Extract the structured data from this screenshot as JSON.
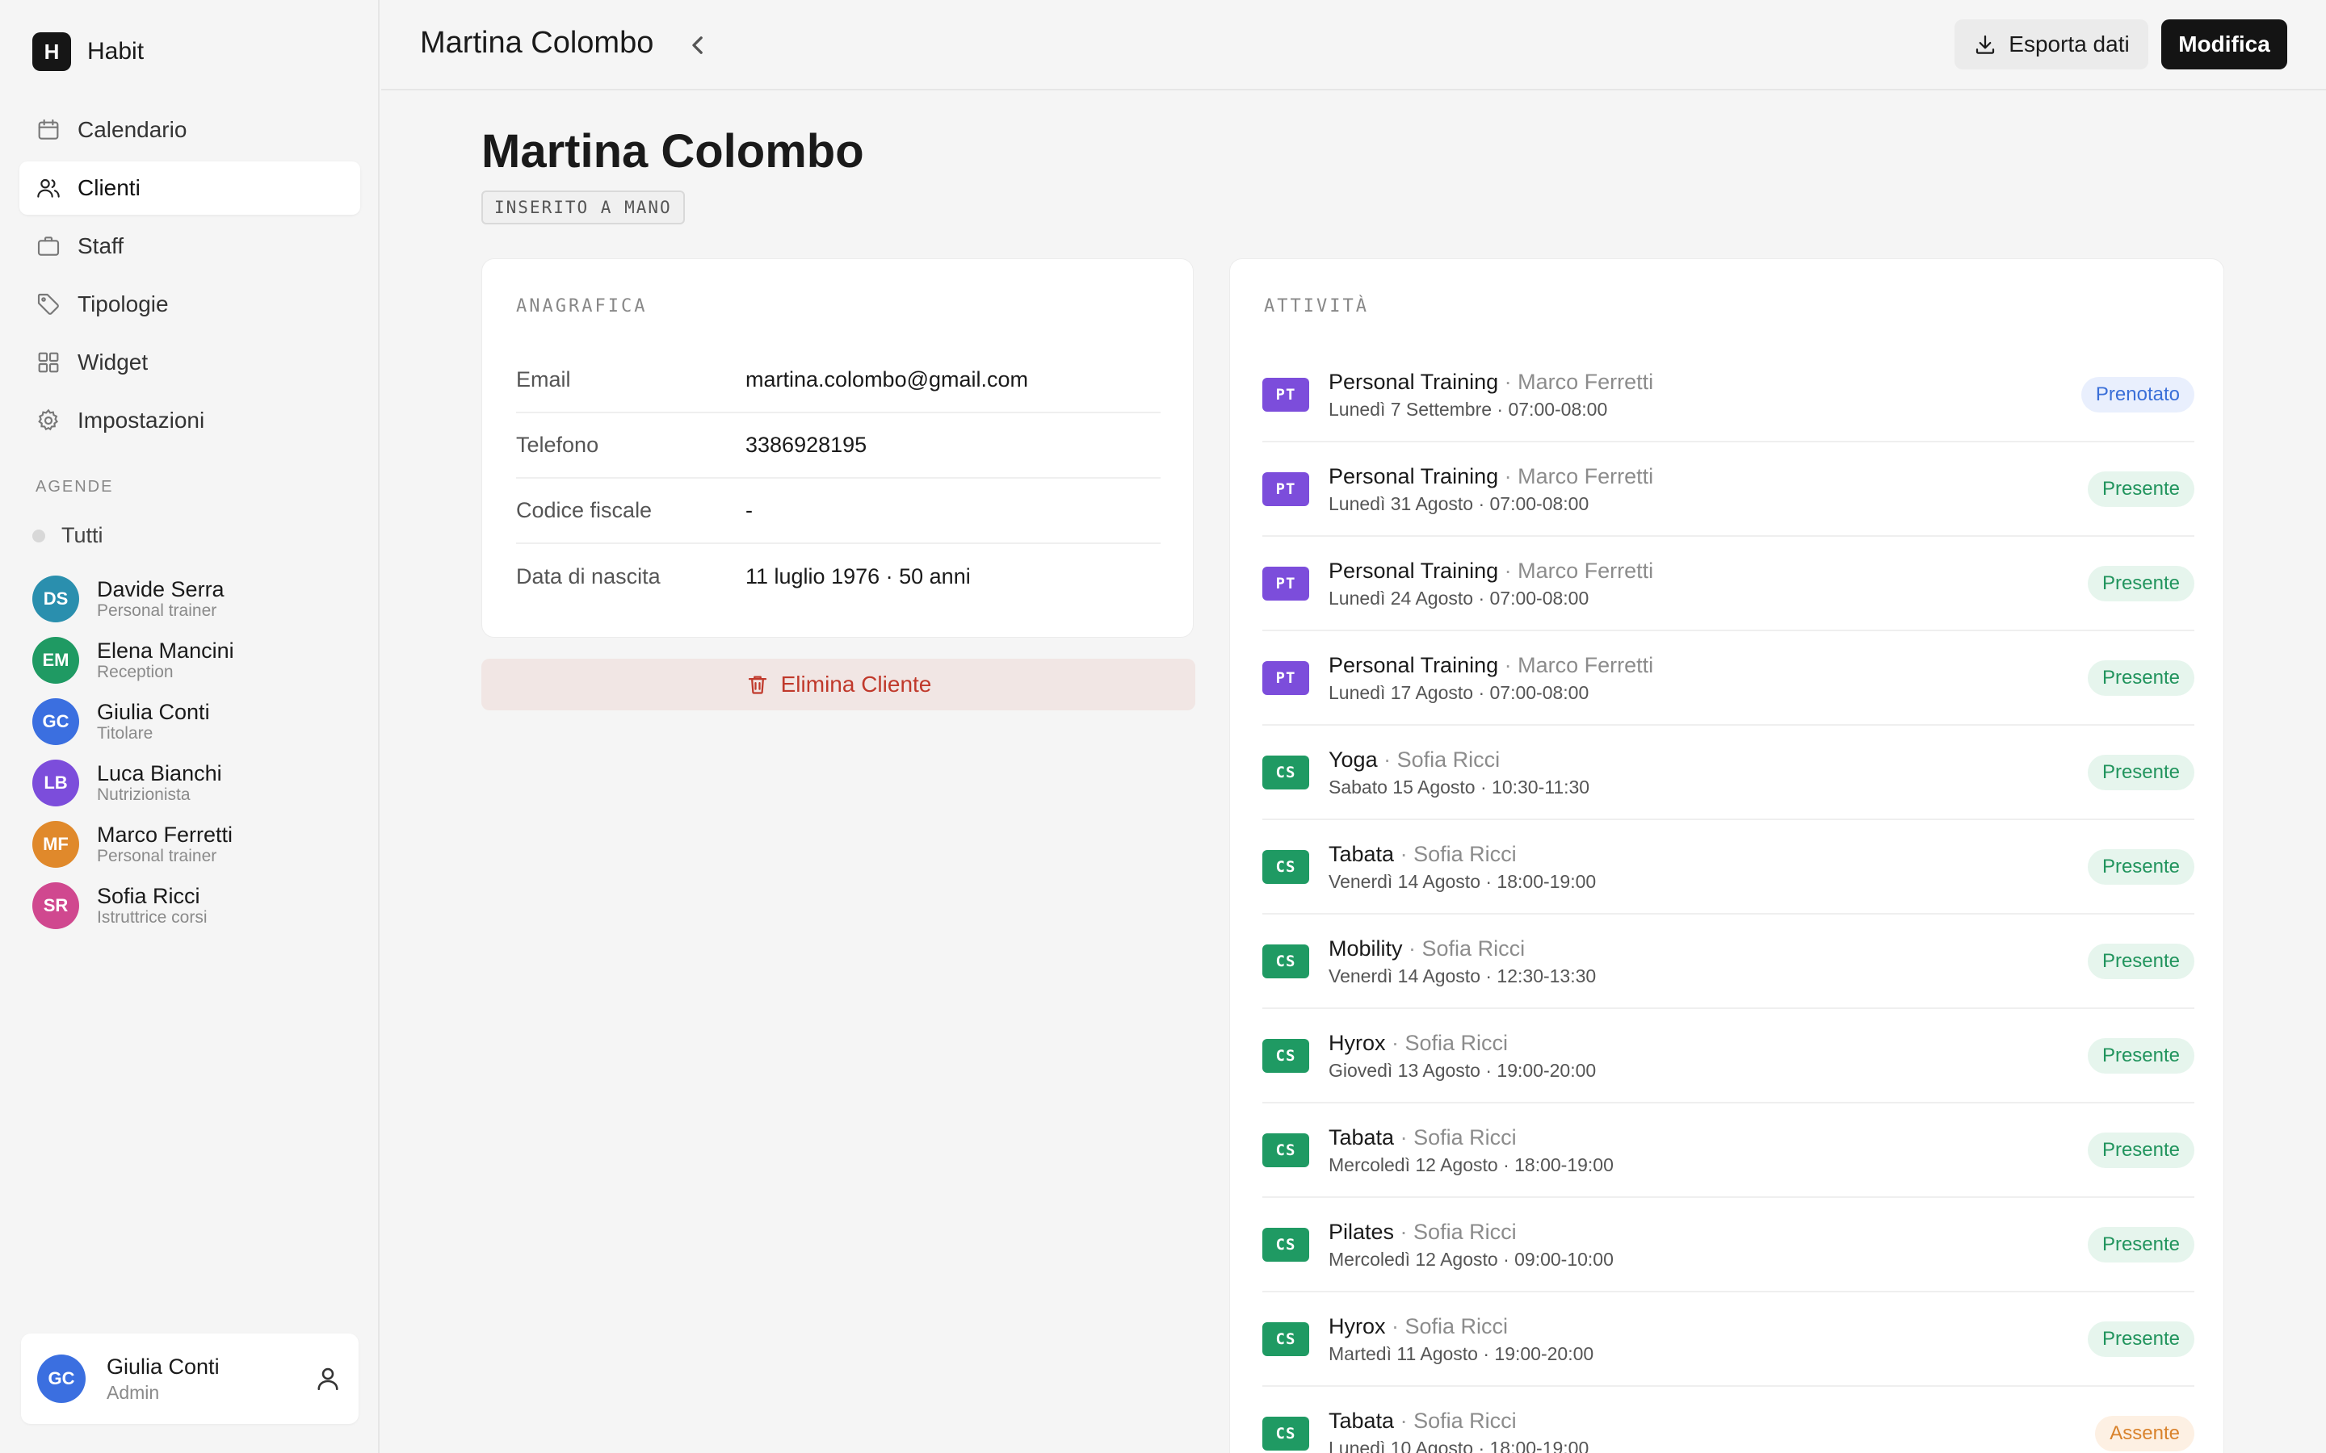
{
  "brand": {
    "logo": "H",
    "name": "Habit"
  },
  "nav": [
    {
      "label": "Calendario",
      "icon": "calendar-icon",
      "active": false
    },
    {
      "label": "Clienti",
      "icon": "users-icon",
      "active": true
    },
    {
      "label": "Staff",
      "icon": "briefcase-icon",
      "active": false
    },
    {
      "label": "Tipologie",
      "icon": "tag-icon",
      "active": false
    },
    {
      "label": "Widget",
      "icon": "grid-icon",
      "active": false
    },
    {
      "label": "Impostazioni",
      "icon": "gear-icon",
      "active": false
    }
  ],
  "agende": {
    "label": "AGENDE",
    "all_label": "Tutti",
    "staff": [
      {
        "initials": "DS",
        "name": "Davide Serra",
        "role": "Personal trainer",
        "color": "#2a8fae"
      },
      {
        "initials": "EM",
        "name": "Elena Mancini",
        "role": "Reception",
        "color": "#1f9a63"
      },
      {
        "initials": "GC",
        "name": "Giulia Conti",
        "role": "Titolare",
        "color": "#3b6fe0"
      },
      {
        "initials": "LB",
        "name": "Luca Bianchi",
        "role": "Nutrizionista",
        "color": "#7c4ddb"
      },
      {
        "initials": "MF",
        "name": "Marco Ferretti",
        "role": "Personal trainer",
        "color": "#e0892b"
      },
      {
        "initials": "SR",
        "name": "Sofia Ricci",
        "role": "Istruttrice corsi",
        "color": "#d0488f"
      }
    ]
  },
  "user": {
    "initials": "GC",
    "name": "Giulia Conti",
    "role": "Admin",
    "color": "#3b6fe0"
  },
  "header": {
    "title": "Martina Colombo",
    "export_label": "Esporta dati",
    "edit_label": "Modifica"
  },
  "client": {
    "name": "Martina Colombo",
    "tag": "INSERITO A MANO",
    "section_label": "ANAGRAFICA",
    "fields": [
      {
        "key": "Email",
        "value": "martina.colombo@gmail.com"
      },
      {
        "key": "Telefono",
        "value": "3386928195"
      },
      {
        "key": "Codice fiscale",
        "value": "-"
      },
      {
        "key": "Data di nascita",
        "value": "11 luglio 1976 · 50 anni"
      }
    ],
    "delete_label": "Elimina Cliente"
  },
  "activity": {
    "label": "ATTIVITÀ",
    "items": [
      {
        "badge": "PT",
        "kind": "pt",
        "title": "Personal Training",
        "who": "Marco Ferretti",
        "when": "Lunedì 7 Settembre · 07:00-08:00",
        "status": "Prenotato",
        "status_kind": "prenotato"
      },
      {
        "badge": "PT",
        "kind": "pt",
        "title": "Personal Training",
        "who": "Marco Ferretti",
        "when": "Lunedì 31 Agosto · 07:00-08:00",
        "status": "Presente",
        "status_kind": "presente"
      },
      {
        "badge": "PT",
        "kind": "pt",
        "title": "Personal Training",
        "who": "Marco Ferretti",
        "when": "Lunedì 24 Agosto · 07:00-08:00",
        "status": "Presente",
        "status_kind": "presente"
      },
      {
        "badge": "PT",
        "kind": "pt",
        "title": "Personal Training",
        "who": "Marco Ferretti",
        "when": "Lunedì 17 Agosto · 07:00-08:00",
        "status": "Presente",
        "status_kind": "presente"
      },
      {
        "badge": "CS",
        "kind": "cs",
        "title": "Yoga",
        "who": "Sofia Ricci",
        "when": "Sabato 15 Agosto · 10:30-11:30",
        "status": "Presente",
        "status_kind": "presente"
      },
      {
        "badge": "CS",
        "kind": "cs",
        "title": "Tabata",
        "who": "Sofia Ricci",
        "when": "Venerdì 14 Agosto · 18:00-19:00",
        "status": "Presente",
        "status_kind": "presente"
      },
      {
        "badge": "CS",
        "kind": "cs",
        "title": "Mobility",
        "who": "Sofia Ricci",
        "when": "Venerdì 14 Agosto · 12:30-13:30",
        "status": "Presente",
        "status_kind": "presente"
      },
      {
        "badge": "CS",
        "kind": "cs",
        "title": "Hyrox",
        "who": "Sofia Ricci",
        "when": "Giovedì 13 Agosto · 19:00-20:00",
        "status": "Presente",
        "status_kind": "presente"
      },
      {
        "badge": "CS",
        "kind": "cs",
        "title": "Tabata",
        "who": "Sofia Ricci",
        "when": "Mercoledì 12 Agosto · 18:00-19:00",
        "status": "Presente",
        "status_kind": "presente"
      },
      {
        "badge": "CS",
        "kind": "cs",
        "title": "Pilates",
        "who": "Sofia Ricci",
        "when": "Mercoledì 12 Agosto · 09:00-10:00",
        "status": "Presente",
        "status_kind": "presente"
      },
      {
        "badge": "CS",
        "kind": "cs",
        "title": "Hyrox",
        "who": "Sofia Ricci",
        "when": "Martedì 11 Agosto · 19:00-20:00",
        "status": "Presente",
        "status_kind": "presente"
      },
      {
        "badge": "CS",
        "kind": "cs",
        "title": "Tabata",
        "who": "Sofia Ricci",
        "when": "Lunedì 10 Agosto · 18:00-19:00",
        "status": "Assente",
        "status_kind": "assente"
      }
    ]
  }
}
